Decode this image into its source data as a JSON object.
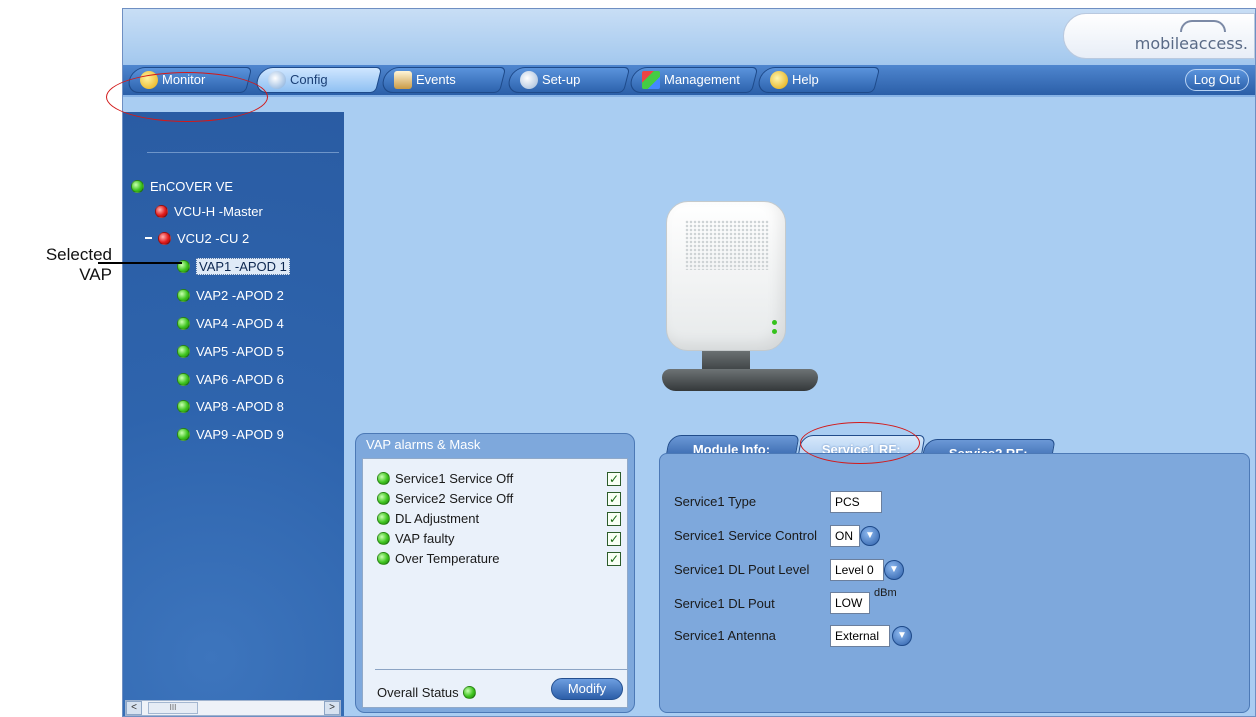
{
  "app": {
    "logo": "mobileaccess."
  },
  "tabs": [
    {
      "label": "Monitor",
      "icon": "monitor-icon"
    },
    {
      "label": "Config",
      "icon": "wrench-icon"
    },
    {
      "label": "Events",
      "icon": "events-icon"
    },
    {
      "label": "Set-up",
      "icon": "setup-icon"
    },
    {
      "label": "Management",
      "icon": "management-icon"
    },
    {
      "label": "Help",
      "icon": "help-icon"
    }
  ],
  "logout_label": "Log Out",
  "tree": {
    "root": "EnCOVER VE",
    "master": "VCU-H -Master",
    "cu2": "VCU2 -CU 2",
    "items": [
      "VAP1 -APOD 1",
      "VAP2 -APOD 2",
      "VAP4 -APOD 4",
      "VAP5 -APOD 5",
      "VAP6 -APOD 6",
      "VAP8 -APOD 8",
      "VAP9 -APOD 9"
    ],
    "scroll_thumb": "III"
  },
  "callout": {
    "line1": "Selected",
    "line2": "VAP"
  },
  "alarms": {
    "title": "VAP alarms & Mask",
    "rows": [
      "Service1 Service Off",
      "Service2 Service Off",
      "DL Adjustment",
      "VAP faulty",
      "Over Temperature"
    ],
    "check_mark": "✓",
    "overall_label": "Overall Status",
    "modify_label": "Modify"
  },
  "rf_tabs": [
    "Module Info:",
    "Service1 RF:",
    "Service2 RF:"
  ],
  "rf": {
    "type_label": "Service1 Type",
    "type_value": "PCS",
    "control_label": "Service1 Service Control",
    "control_value": "ON",
    "dl_level_label": "Service1 DL Pout Level",
    "dl_level_value": "Level 0",
    "dl_pout_label": "Service1 DL Pout",
    "dl_pout_value": "LOW",
    "dl_pout_unit": "dBm",
    "antenna_label": "Service1 Antenna",
    "antenna_value": "External"
  }
}
